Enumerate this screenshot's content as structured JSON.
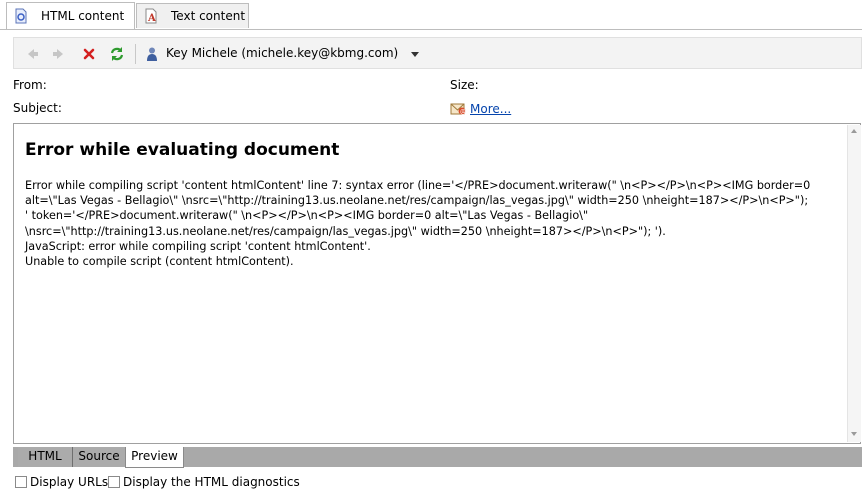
{
  "tabs": [
    {
      "label": "HTML content",
      "icon": "html-document-icon",
      "active": true
    },
    {
      "label": "Text content",
      "icon": "text-document-icon",
      "active": false
    }
  ],
  "toolbar": {
    "back_icon": "arrow-left-icon",
    "forward_icon": "arrow-right-icon",
    "close_icon": "red-x-icon",
    "refresh_icon": "refresh-icon",
    "recipient_icon": "person-icon",
    "recipient": "Key Michele (michele.key@kbmg.com)"
  },
  "headers": {
    "from_label": "From:",
    "size_label": "Size:",
    "subject_label": "Subject:",
    "more_link": "More..."
  },
  "content": {
    "title": "Error while evaluating document",
    "lines": [
      "Error while compiling script 'content htmlContent' line 7: syntax error (line='</PRE>document.writeraw(\" \\n<P></P>\\n<P><IMG border=0",
      "alt=\\\"Las Vegas - Bellagio\\\" \\nsrc=\\\"http://training13.us.neolane.net/res/campaign/las_vegas.jpg\\\" width=250 \\nheight=187></P>\\n<P>\");",
      "' token='</PRE>document.writeraw(\" \\n<P></P>\\n<P><IMG border=0 alt=\\\"Las Vegas - Bellagio\\\"",
      "\\nsrc=\\\"http://training13.us.neolane.net/res/campaign/las_vegas.jpg\\\" width=250 \\nheight=187></P>\\n<P>\"); ').",
      "JavaScript: error while compiling script 'content htmlContent'.",
      "Unable to compile script (content htmlContent)."
    ]
  },
  "bottom_tabs": [
    {
      "label": "HTML",
      "active": false
    },
    {
      "label": "Source",
      "active": false
    },
    {
      "label": "Preview",
      "active": true
    }
  ],
  "options": {
    "display_urls": "Display URLs",
    "display_diagnostics": "Display the HTML diagnostics"
  },
  "colors": {
    "link": "#0645ad",
    "bottom_tab_bar": "#a9a9a9"
  }
}
